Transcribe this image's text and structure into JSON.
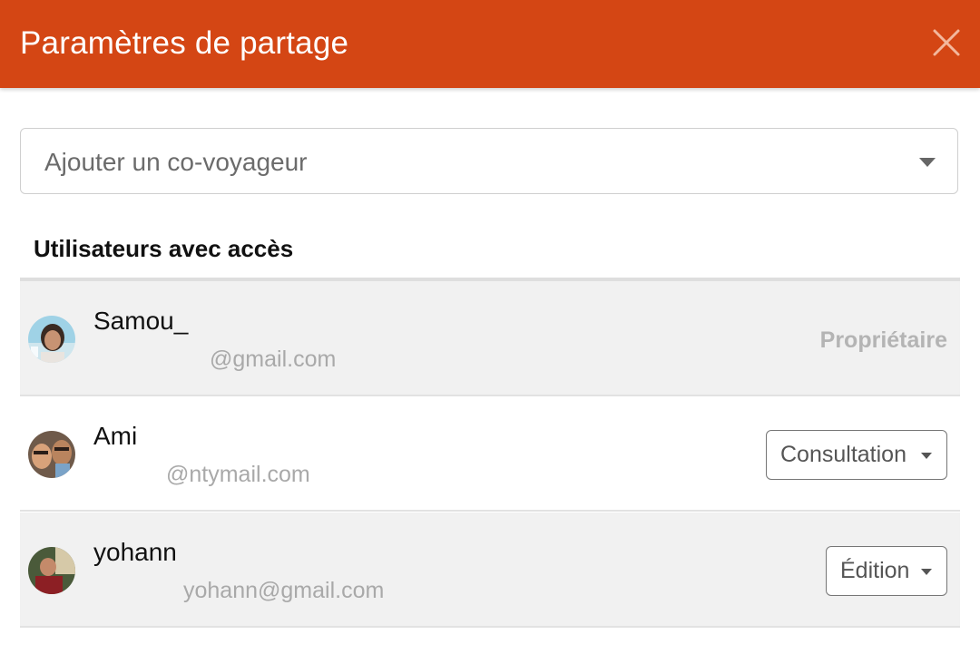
{
  "dialog": {
    "title": "Paramètres de partage",
    "close_icon": "close-icon",
    "header_color": "#d44614"
  },
  "add_traveler": {
    "placeholder": "Ajouter un co-voyageur",
    "icon": "chevron-down-icon"
  },
  "users_section": {
    "title": "Utilisateurs avec accès",
    "users": [
      {
        "name": "Samou_",
        "email": "@gmail.com",
        "role": "Propriétaire",
        "role_editable": false
      },
      {
        "name": "Ami",
        "email": "@ntymail.com",
        "role": "Consultation",
        "role_editable": true
      },
      {
        "name": "yohann",
        "email": "yohann@gmail.com",
        "role": "Édition",
        "role_editable": true
      }
    ]
  }
}
